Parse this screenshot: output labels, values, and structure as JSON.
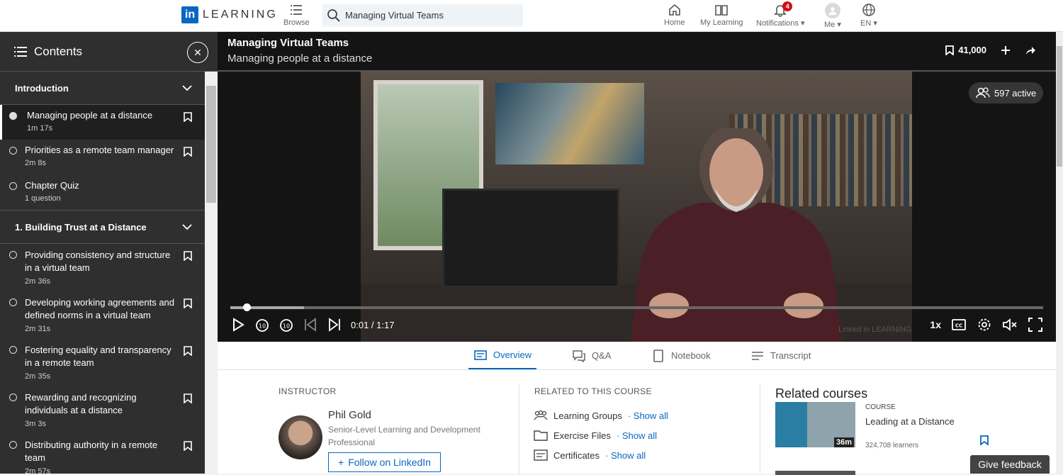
{
  "nav": {
    "logo_letters": "in",
    "brand": "LEARNING",
    "browse": "Browse",
    "search_value": "Managing Virtual Teams",
    "home": "Home",
    "my_learning": "My Learning",
    "notifications": "Notifications",
    "notification_count": "4",
    "me": "Me",
    "lang": "EN"
  },
  "sidebar": {
    "title": "Contents",
    "sections": [
      {
        "title": "Introduction",
        "items": [
          {
            "title": "Managing people at a distance",
            "duration": "1m 17s"
          },
          {
            "title": "Priorities as a remote team manager",
            "duration": "2m 8s"
          },
          {
            "title": "Chapter Quiz",
            "duration": "1 question"
          }
        ]
      },
      {
        "title": "1. Building Trust at a Distance",
        "items": [
          {
            "title": "Providing consistency and structure in a virtual team",
            "duration": "2m 36s"
          },
          {
            "title": "Developing working agreements and defined norms in a virtual team",
            "duration": "2m 31s"
          },
          {
            "title": "Fostering equality and transparency in a remote team",
            "duration": "2m 35s"
          },
          {
            "title": "Rewarding and recognizing individuals at a distance",
            "duration": "3m 3s"
          },
          {
            "title": "Distributing authority in a remote team",
            "duration": "2m 57s"
          }
        ]
      }
    ]
  },
  "video": {
    "course_title": "Managing Virtual Teams",
    "video_title": "Managing people at a distance",
    "saves": "41,000",
    "active": "597 active",
    "time": "0:01 / 1:17",
    "speed": "1x",
    "watermark": "Linked in LEARNING",
    "progress_fraction": 0.016
  },
  "tabs": [
    "Overview",
    "Q&A",
    "Notebook",
    "Transcript"
  ],
  "instructor": {
    "label": "INSTRUCTOR",
    "name": "Phil Gold",
    "title": "Senior-Level Learning and Development Professional",
    "follow": "Follow on LinkedIn"
  },
  "related": {
    "label": "RELATED TO THIS COURSE",
    "items": [
      {
        "label": "Learning Groups",
        "show": "· Show all"
      },
      {
        "label": "Exercise Files",
        "show": "· Show all"
      },
      {
        "label": "Certificates",
        "show": "· Show all"
      }
    ]
  },
  "related_courses": {
    "heading": "Related courses",
    "type": "COURSE",
    "title": "Leading at a Distance",
    "learners": "324,708 learners",
    "duration": "36m"
  },
  "feedback": "Give feedback"
}
